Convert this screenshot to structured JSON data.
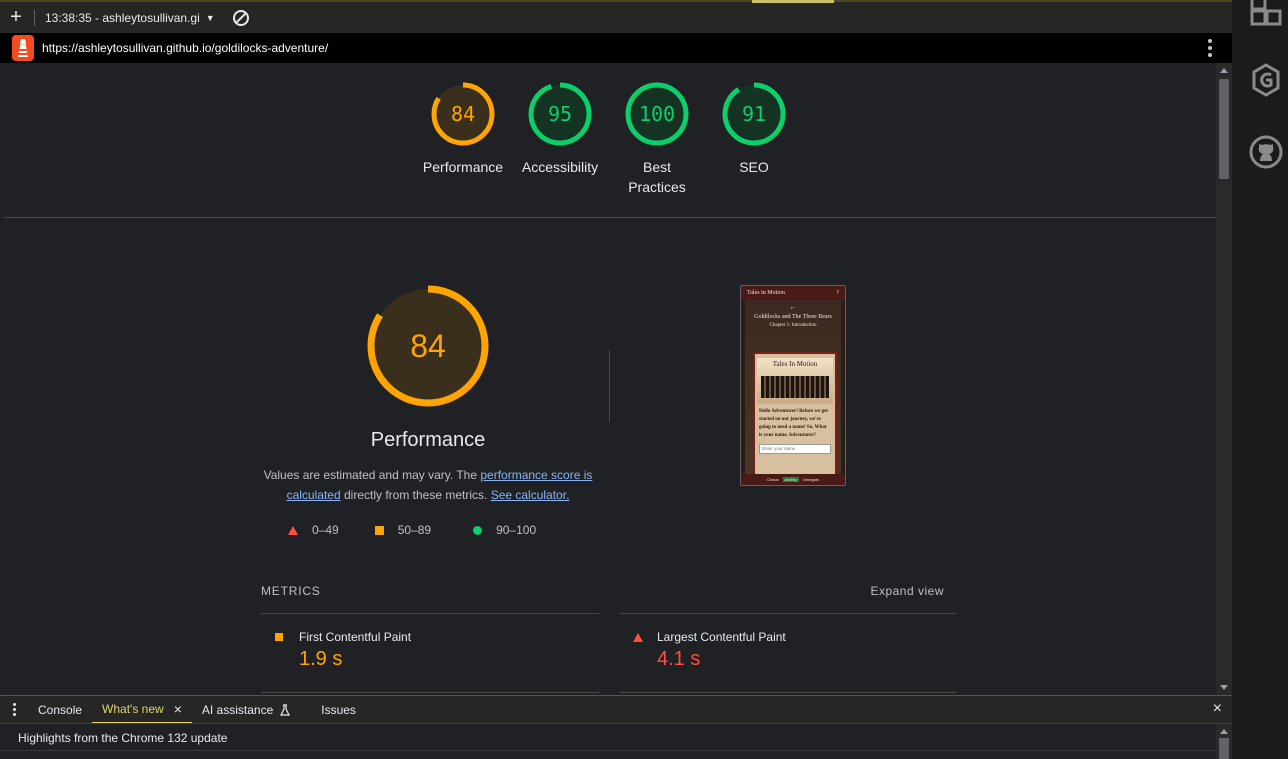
{
  "toolbar": {
    "new_label": "+",
    "report_label": "13:38:35 - ashleytosullivan.gi",
    "caret": "▼"
  },
  "urlbar": {
    "url": "https://ashleytosullivan.github.io/goldilocks-adventure/"
  },
  "scores": [
    {
      "value": "84",
      "label": "Performance",
      "score": 0.84,
      "color": "#ffa400",
      "bg": "#3a2f1d"
    },
    {
      "value": "95",
      "label": "Accessibility",
      "score": 0.95,
      "color": "#0cce6b",
      "bg": "#143322"
    },
    {
      "value": "100",
      "label": "Best Practices",
      "score": 1.0,
      "color": "#0cce6b",
      "bg": "#143322"
    },
    {
      "value": "91",
      "label": "SEO",
      "score": 0.91,
      "color": "#0cce6b",
      "bg": "#143322"
    }
  ],
  "performance": {
    "score": "84",
    "fraction": 0.84,
    "title": "Performance",
    "desc_prefix": "Values are estimated and may vary. The ",
    "link1": "performance score is calculated",
    "desc_mid": " directly from these metrics. ",
    "link2": "See calculator."
  },
  "legend": {
    "fail": "0–49",
    "average": "50–89",
    "pass": "90–100"
  },
  "screenshot": {
    "header": "Tales in Motion",
    "help": "?",
    "arrow": "←",
    "title": "Goldilocks and The Three Bears",
    "chapter": "Chapter 1: Introduction",
    "logo_text": "Tales In Motion",
    "body": "Hello Adventurer! Before we get started on our journey, we're going to need a name! So, What is your name, Adventurer?",
    "input_placeholder": "Enter your name",
    "footer": [
      "Chaos",
      "Ashley",
      "Omegain"
    ]
  },
  "metrics": {
    "heading": "METRICS",
    "expand": "Expand view",
    "items": [
      {
        "name": "First Contentful Paint",
        "value": "1.9 s",
        "status": "average",
        "color": "#ffa400"
      },
      {
        "name": "Largest Contentful Paint",
        "value": "4.1 s",
        "status": "fail",
        "color": "#ff4e42"
      }
    ]
  },
  "drawer": {
    "tabs": [
      "Console",
      "What's new",
      "AI assistance",
      "Issues"
    ],
    "active_tab": "What's new",
    "close": "×",
    "highlight": "Highlights from the Chrome 132 update"
  },
  "sidebar": {
    "icons": [
      "extensions-icon",
      "grammarly-icon",
      "github-icon"
    ]
  }
}
